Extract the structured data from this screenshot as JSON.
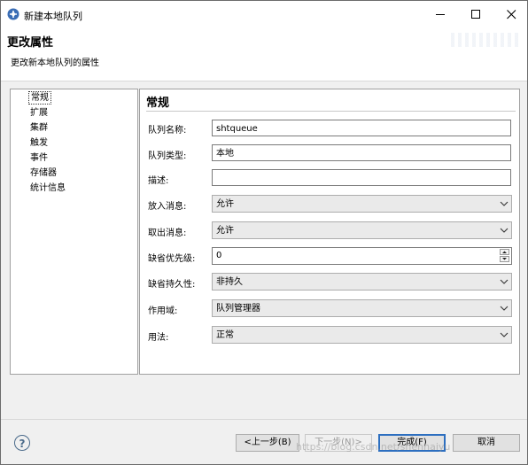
{
  "window": {
    "title": "新建本地队列"
  },
  "header": {
    "title": "更改属性",
    "description": "更改新本地队列的属性"
  },
  "nav": {
    "items": [
      {
        "label": "常规",
        "selected": true
      },
      {
        "label": "扩展",
        "selected": false
      },
      {
        "label": "集群",
        "selected": false
      },
      {
        "label": "触发",
        "selected": false
      },
      {
        "label": "事件",
        "selected": false
      },
      {
        "label": "存储器",
        "selected": false
      },
      {
        "label": "统计信息",
        "selected": false
      }
    ]
  },
  "content": {
    "title": "常规",
    "fields": {
      "queue_name": {
        "label": "队列名称:",
        "value": "shtqueue"
      },
      "queue_type": {
        "label": "队列类型:",
        "value": "本地"
      },
      "description": {
        "label": "描述:",
        "value": ""
      },
      "put_messages": {
        "label": "放入消息:",
        "value": "允许"
      },
      "get_messages": {
        "label": "取出消息:",
        "value": "允许"
      },
      "default_priority": {
        "label": "缺省优先级:",
        "value": "0"
      },
      "default_persistence": {
        "label": "缺省持久性:",
        "value": "非持久"
      },
      "scope": {
        "label": "作用域:",
        "value": "队列管理器"
      },
      "usage": {
        "label": "用法:",
        "value": "正常"
      }
    }
  },
  "footer": {
    "back_label": "<上一步(B)",
    "next_label": "下一步(N)>",
    "finish_label": "完成(F)",
    "cancel_label": "取消",
    "watermark": "https://blog.csdn.net/shenhaiyu"
  },
  "colors": {
    "accent": "#2d6fc0",
    "panel_border": "#a0a0a0"
  }
}
